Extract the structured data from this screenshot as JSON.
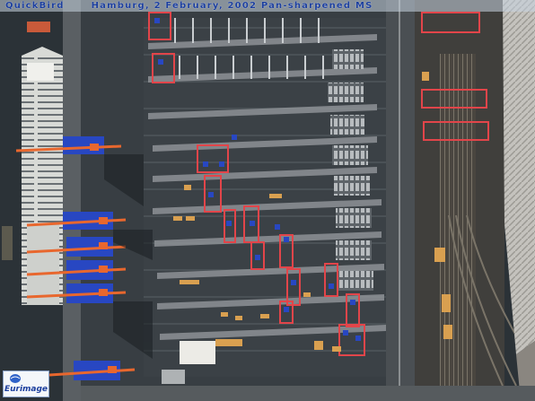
{
  "caption": {
    "brand": "QuickBird",
    "description": "Hamburg, 2 February, 2002 Pan-sharpened MS"
  },
  "logo": {
    "text": "Eurimage"
  },
  "colors": {
    "water": "#2b3237",
    "quay": "#3a4045",
    "crane_red": "#e2454a",
    "crane_blue": "#2847c2",
    "crane_orange": "#e8672e",
    "caption_text": "#1c3f9e",
    "caption_band": "#c8d6e2"
  }
}
